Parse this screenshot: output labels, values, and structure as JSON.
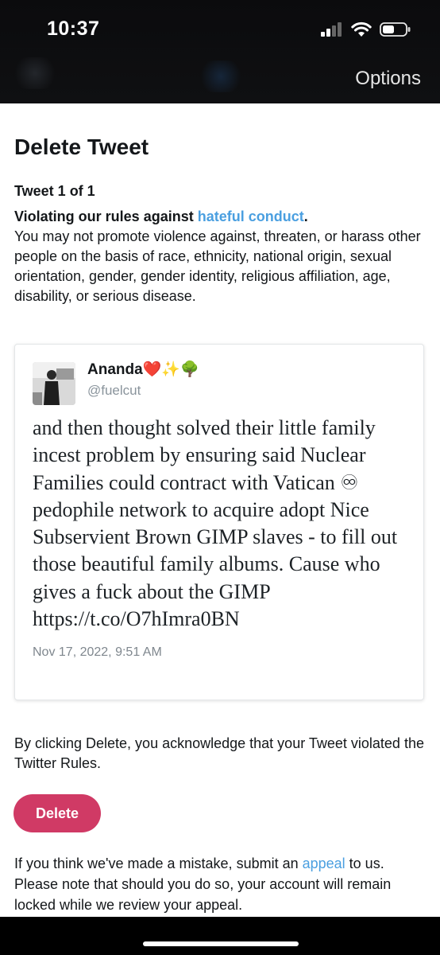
{
  "status_bar": {
    "time": "10:37"
  },
  "nav": {
    "options_label": "Options"
  },
  "page": {
    "title": "Delete Tweet",
    "tweet_count": "Tweet 1 of 1",
    "rule_prefix": "Violating our rules against ",
    "rule_link": "hateful conduct",
    "rule_suffix": ".",
    "rule_body": "You may not promote violence against, threaten, or harass other people on the basis of race, ethnicity, national origin, sexual orientation, gender, gender identity, religious affiliation, age, disability, or serious disease."
  },
  "tweet": {
    "author_name": "Ananda",
    "emojis": [
      "❤️",
      "✨",
      "🌳"
    ],
    "handle": "@fuelcut",
    "text": "and then thought solved their little family incest problem by ensuring said Nuclear Families could contract with Vatican ♾ pedophile network to acquire adopt Nice Subservient Brown GIMP slaves - to fill out those beautiful family albums. Cause who gives a fuck about the GIMP https://t.co/O7hImra0BN",
    "date": "Nov 17, 2022, 9:51 AM"
  },
  "acknowledge_text": "By clicking Delete, you acknowledge that your Tweet violated the Twitter Rules.",
  "delete_button_label": "Delete",
  "appeal": {
    "prefix": "If you think we've made a mistake, submit an ",
    "link": "appeal",
    "suffix": " to us. Please note that should you do so, your account will remain locked while we review your appeal."
  },
  "colors": {
    "link": "#4a9fe0",
    "delete_button": "#d03a65",
    "top_bar": "#0b0b0d"
  }
}
